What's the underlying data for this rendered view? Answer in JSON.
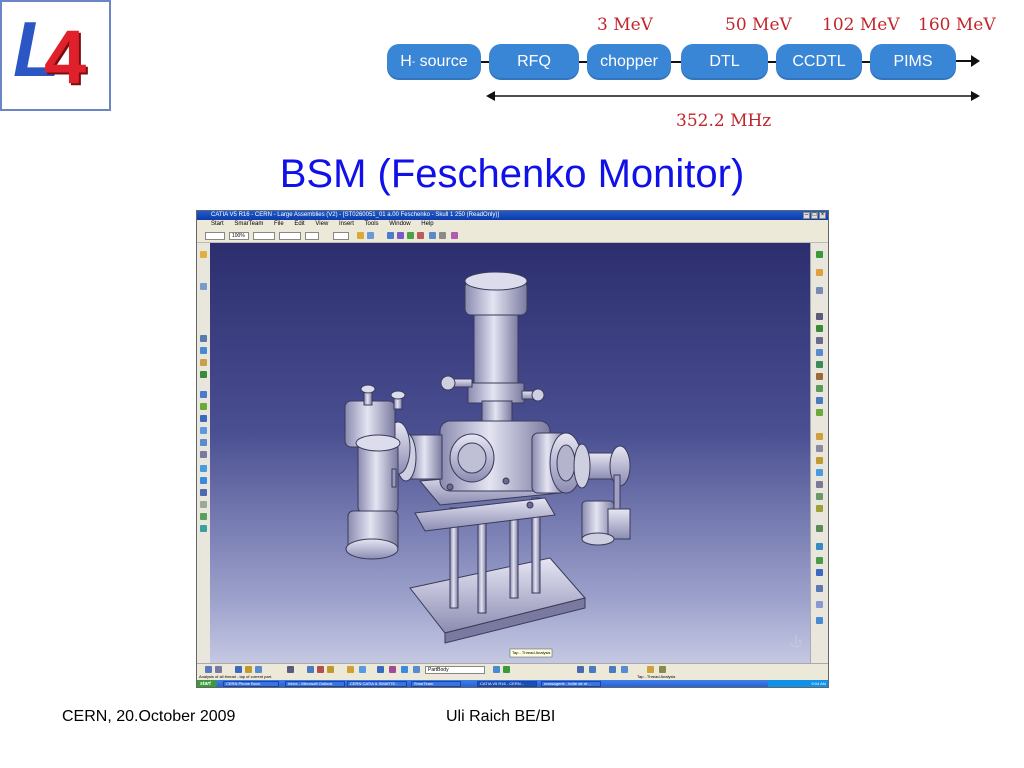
{
  "logo": {
    "letter": "L",
    "digit": "4"
  },
  "chain": {
    "energies": [
      "3 MeV",
      "50 MeV",
      "102 MeV",
      "160 MeV"
    ],
    "stages": [
      "H",
      "RFQ",
      "chopper",
      "DTL",
      "CCDTL",
      "PIMS"
    ],
    "source_superscript": "-",
    "source_suffix": "source",
    "frequency": "352.2 MHz",
    "colors": {
      "stage_fill": "#3a86d6",
      "energy_text": "#c0262c"
    }
  },
  "title": "BSM (Feschenko Monitor)",
  "screenshot": {
    "app_title": "CATIA V5 R16 - CERN - Large Assemblies (V2) - [ST0260051_01 a.00 Feschenko - Skull 1 250 (ReadOnly)]",
    "menus": [
      "Start",
      "SmarTeam",
      "File",
      "Edit",
      "View",
      "Insert",
      "Tools",
      "Window",
      "Help"
    ],
    "toolbar_fields": [
      "100%",
      "PartBody"
    ],
    "status_left": "Analysis of all thread - tap of current part.",
    "status_right": "Tap - Thread Analysis",
    "tooltip": "Tap - Thread Analysis",
    "taskbar": {
      "start": "start",
      "items": [
        "CERN Phone Book",
        "Inbox - Microsoft Outlook",
        "CERN CATIA & SMARTE...",
        "SmarTeam",
        "CATIA V5 R16 - CERN...",
        "messagerie - boîte de ré..."
      ],
      "clock": "9:04 AM"
    }
  },
  "footer": {
    "left": "CERN, 20.October 2009",
    "center": "Uli Raich BE/BI"
  }
}
